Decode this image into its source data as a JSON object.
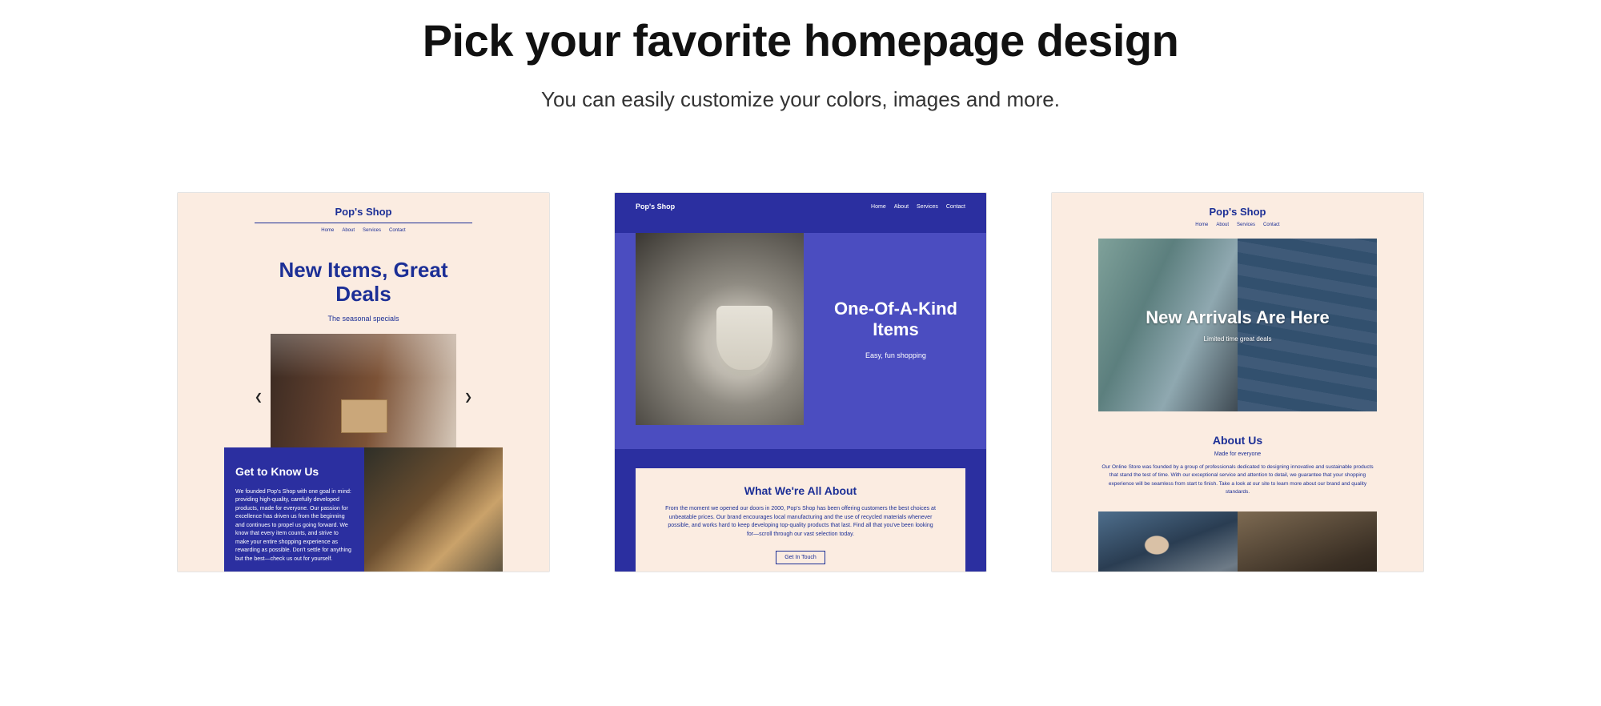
{
  "page": {
    "title": "Pick your favorite homepage design",
    "subtitle": "You can easily customize your colors, images and more."
  },
  "nav_items": [
    "Home",
    "About",
    "Services",
    "Contact"
  ],
  "shop_name": "Pop's Shop",
  "templates": {
    "t1": {
      "hero_title": "New Items, Great Deals",
      "hero_sub": "The seasonal specials",
      "know_title": "Get to Know Us",
      "know_body": "We founded Pop's Shop with one goal in mind: providing high-quality, carefully developed products, made for everyone. Our passion for excellence has driven us from the beginning and continues to propel us going forward. We know that every item counts, and strive to make your entire shopping experience as rewarding as possible. Don't settle for anything but the best—check us out for yourself."
    },
    "t2": {
      "hero_title": "One-Of-A-Kind Items",
      "hero_sub": "Easy, fun shopping",
      "about_title": "What We're All About",
      "about_body": "From the moment we opened our doors in 2000, Pop's Shop has been offering customers the best choices at unbeatable prices. Our brand encourages local manufacturing and the use of recycled materials whenever possible, and works hard to keep developing top-quality products that last. Find all that you've been looking for—scroll through our vast selection today.",
      "about_cta": "Get In Touch"
    },
    "t3": {
      "hero_title": "New Arrivals Are Here",
      "hero_sub": "Limited time great deals",
      "about_title": "About Us",
      "about_made": "Made for everyone",
      "about_body": "Our Online Store was founded by a group of professionals dedicated to designing innovative and sustainable products that stand the test of time. With our exceptional service and attention to detail, we guarantee that your shopping experience will be seamless from start to finish. Take a look at our site to learn more about our brand and quality standards."
    }
  }
}
